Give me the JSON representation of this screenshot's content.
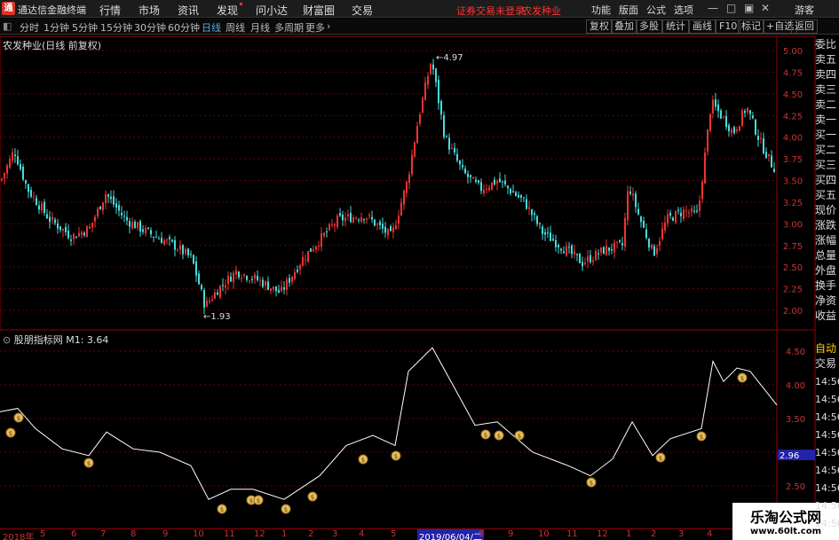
{
  "app": {
    "name": "通达信金融终端",
    "status": "证券交易未登录",
    "stock": "农发种业"
  },
  "menu": [
    "行情",
    "市场",
    "资讯",
    "发现",
    "问小达",
    "财富圈",
    "交易"
  ],
  "right_menu": [
    "功能",
    "版面",
    "公式",
    "选项"
  ],
  "guest": "游客",
  "periods": [
    "分时",
    "1分钟",
    "5分钟",
    "15分钟",
    "30分钟",
    "60分钟",
    "日线",
    "周线",
    "月线",
    "多周期",
    "更多"
  ],
  "active_period": "日线",
  "tool_buttons": [
    "复权",
    "叠加",
    "多股",
    "统计",
    "画线",
    "F10",
    "+自选",
    "返回"
  ],
  "chart_title": "农发种业(日线 前复权)",
  "indicator_title": "股朋指标网",
  "indicator_value": "M1: 3.64",
  "price_axis": [
    "5.00",
    "4.75",
    "4.50",
    "4.25",
    "4.00",
    "3.75",
    "3.50",
    "3.25",
    "3.00",
    "2.75",
    "2.50",
    "2.25",
    "2.00"
  ],
  "high_label": "4.97",
  "low_label": "1.93",
  "ind_axis": [
    "4.50",
    "4.00",
    "3.50",
    "3.00",
    "2.50"
  ],
  "ind_current": "2.96",
  "right_panel": [
    "委比",
    "卖五",
    "卖四",
    "卖三",
    "卖二",
    "卖一",
    "买一",
    "买二",
    "买三",
    "买四",
    "买五",
    "现价",
    "涨跌",
    "涨幅",
    "总量",
    "外盘",
    "换手",
    "净资",
    "收益"
  ],
  "right_panel2": [
    "自动",
    "交易"
  ],
  "time_list": [
    "14:56",
    "14:56",
    "14:56",
    "14:56",
    "14:56",
    "14:56",
    "14:56",
    "14:56",
    "14:56"
  ],
  "months": [
    "2018年",
    "5",
    "6",
    "7",
    "8",
    "9",
    "10",
    "11",
    "12",
    "1",
    "2",
    "3",
    "4",
    "5",
    "6",
    "8",
    "9",
    "10",
    "11",
    "12",
    "1",
    "2",
    "3",
    "4"
  ],
  "date_highlight": "2019/06/04/二",
  "watermark": {
    "line1": "乐淘公式网",
    "line2": "www.60lt.com"
  },
  "colors": {
    "up": "#e33",
    "down": "#4dd",
    "grid": "#700",
    "line": "#fff"
  }
}
